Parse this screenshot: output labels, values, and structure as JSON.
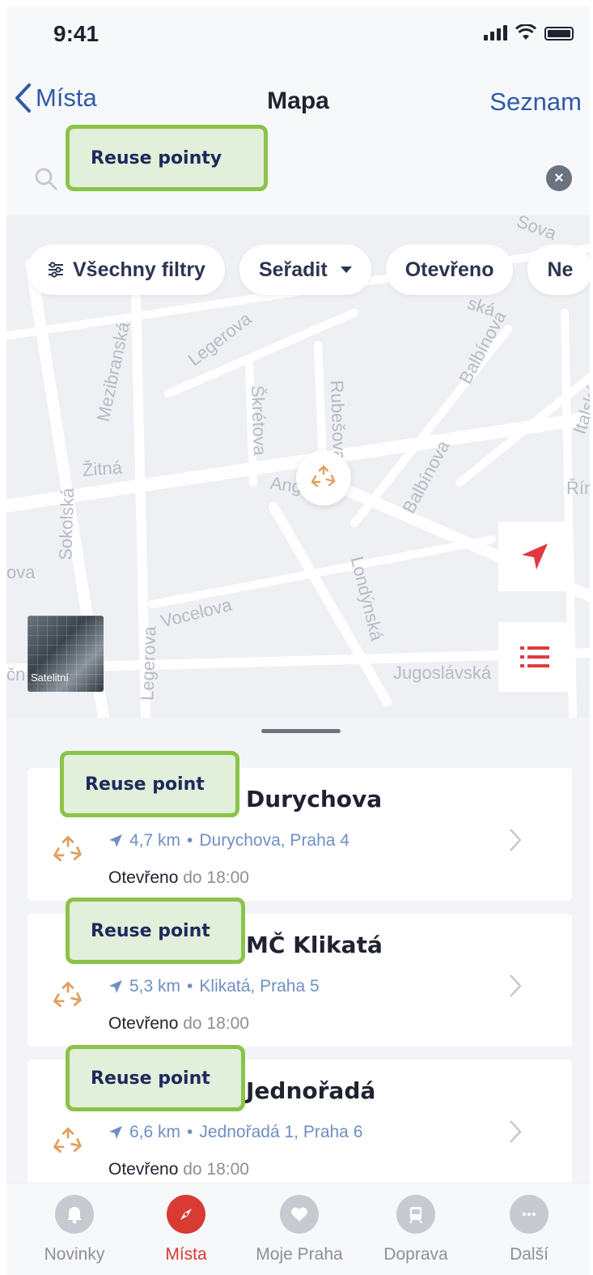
{
  "status_bar": {
    "time": "9:41"
  },
  "nav": {
    "back_label": "Místa",
    "title": "Mapa",
    "right_label": "Seznam"
  },
  "search": {
    "annotation": "Reuse pointy",
    "clear_icon": "clear-icon"
  },
  "filters": [
    {
      "label": "Všechny filtry",
      "icon": "sliders-icon"
    },
    {
      "label": "Seřadit",
      "icon": "caret-down-icon"
    },
    {
      "label": "Otevřeno"
    },
    {
      "label": "Ne"
    }
  ],
  "map": {
    "streets": [
      "Mezibranská",
      "Legerova",
      "Škrétova",
      "Rubešova",
      "Balbínova",
      "Balbínova",
      "Žitná",
      "Sokolská",
      "Ang",
      "Londýnská",
      "Vocelova",
      "Legerova",
      "Jugoslávská",
      "Italská",
      "Řím",
      "ova",
      "Sova",
      "ská",
      "čn"
    ],
    "satellite_label": "Satelitní",
    "accent_color": "#e03a3e"
  },
  "places": [
    {
      "annotation": "Reuse point",
      "title": "Durychova",
      "distance": "4,7 km",
      "separator": "•",
      "address": "Durychova, Praha 4",
      "open_label": "Otevřeno",
      "open_until": "do 18:00"
    },
    {
      "annotation": "Reuse point",
      "title": "MČ Klikatá",
      "distance": "5,3 km",
      "separator": "•",
      "address": "Klikatá, Praha 5",
      "open_label": "Otevřeno",
      "open_until": "do 18:00"
    },
    {
      "annotation": "Reuse point",
      "title": "Jednořadá",
      "distance": "6,6 km",
      "separator": "•",
      "address": "Jednořadá 1, Praha 6",
      "open_label": "Otevřeno",
      "open_until": "do 18:00"
    }
  ],
  "tabbar": [
    {
      "label": "Novinky",
      "icon": "bell-icon"
    },
    {
      "label": "Místa",
      "icon": "compass-icon",
      "active": true
    },
    {
      "label": "Moje Praha",
      "icon": "heart-icon"
    },
    {
      "label": "Doprava",
      "icon": "tram-icon"
    },
    {
      "label": "Další",
      "icon": "more-icon"
    }
  ]
}
